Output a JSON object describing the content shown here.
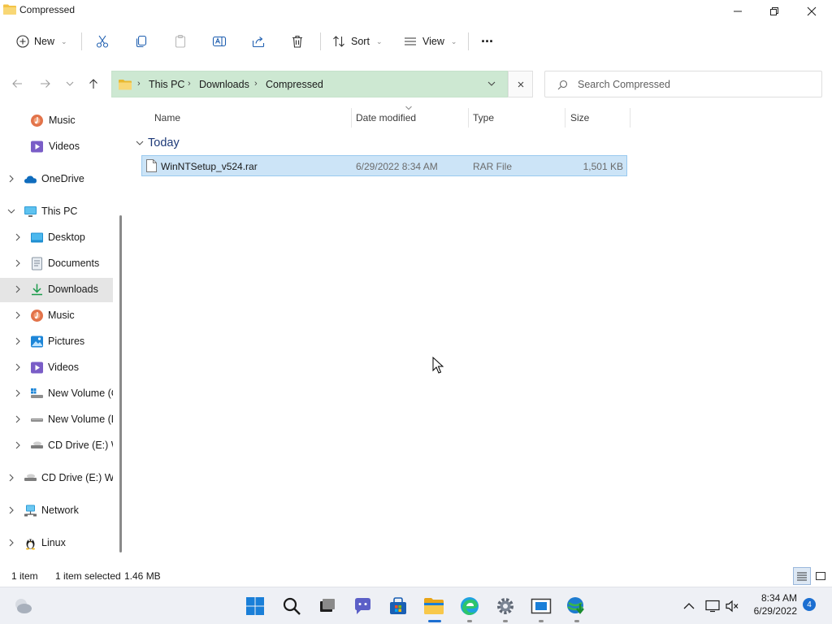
{
  "window": {
    "title": "Compressed"
  },
  "toolbar": {
    "new_label": "New",
    "sort_label": "Sort",
    "view_label": "View",
    "more_label": "···"
  },
  "address": {
    "crumbs": [
      "This PC",
      "Downloads",
      "Compressed"
    ],
    "search_placeholder": "Search Compressed"
  },
  "sidebar": {
    "items": [
      {
        "label": "Music"
      },
      {
        "label": "Videos"
      },
      {
        "label": "OneDrive"
      },
      {
        "label": "This PC"
      },
      {
        "label": "Desktop"
      },
      {
        "label": "Documents"
      },
      {
        "label": "Downloads"
      },
      {
        "label": "Music"
      },
      {
        "label": "Pictures"
      },
      {
        "label": "Videos"
      },
      {
        "label": "New Volume (C"
      },
      {
        "label": "New Volume (D"
      },
      {
        "label": "CD Drive (E:) W"
      },
      {
        "label": "CD Drive (E:) Wir"
      },
      {
        "label": "Network"
      },
      {
        "label": "Linux"
      }
    ]
  },
  "filelist": {
    "columns": [
      "Name",
      "Date modified",
      "Type",
      "Size"
    ],
    "group": "Today",
    "rows": [
      {
        "name": "WinNTSetup_v524.rar",
        "date": "6/29/2022 8:34 AM",
        "type": "RAR File",
        "size": "1,501 KB"
      }
    ]
  },
  "status": {
    "count": "1 item",
    "selected": "1 item selected",
    "size": "1.46 MB"
  },
  "taskbar": {
    "time": "8:34 AM",
    "date": "6/29/2022",
    "notifications": "4"
  },
  "colors": {
    "address_bg": "#cde8d2",
    "selection_bg": "#cce4f7",
    "accent": "#1c6fd1",
    "folder": "#f3c346"
  }
}
